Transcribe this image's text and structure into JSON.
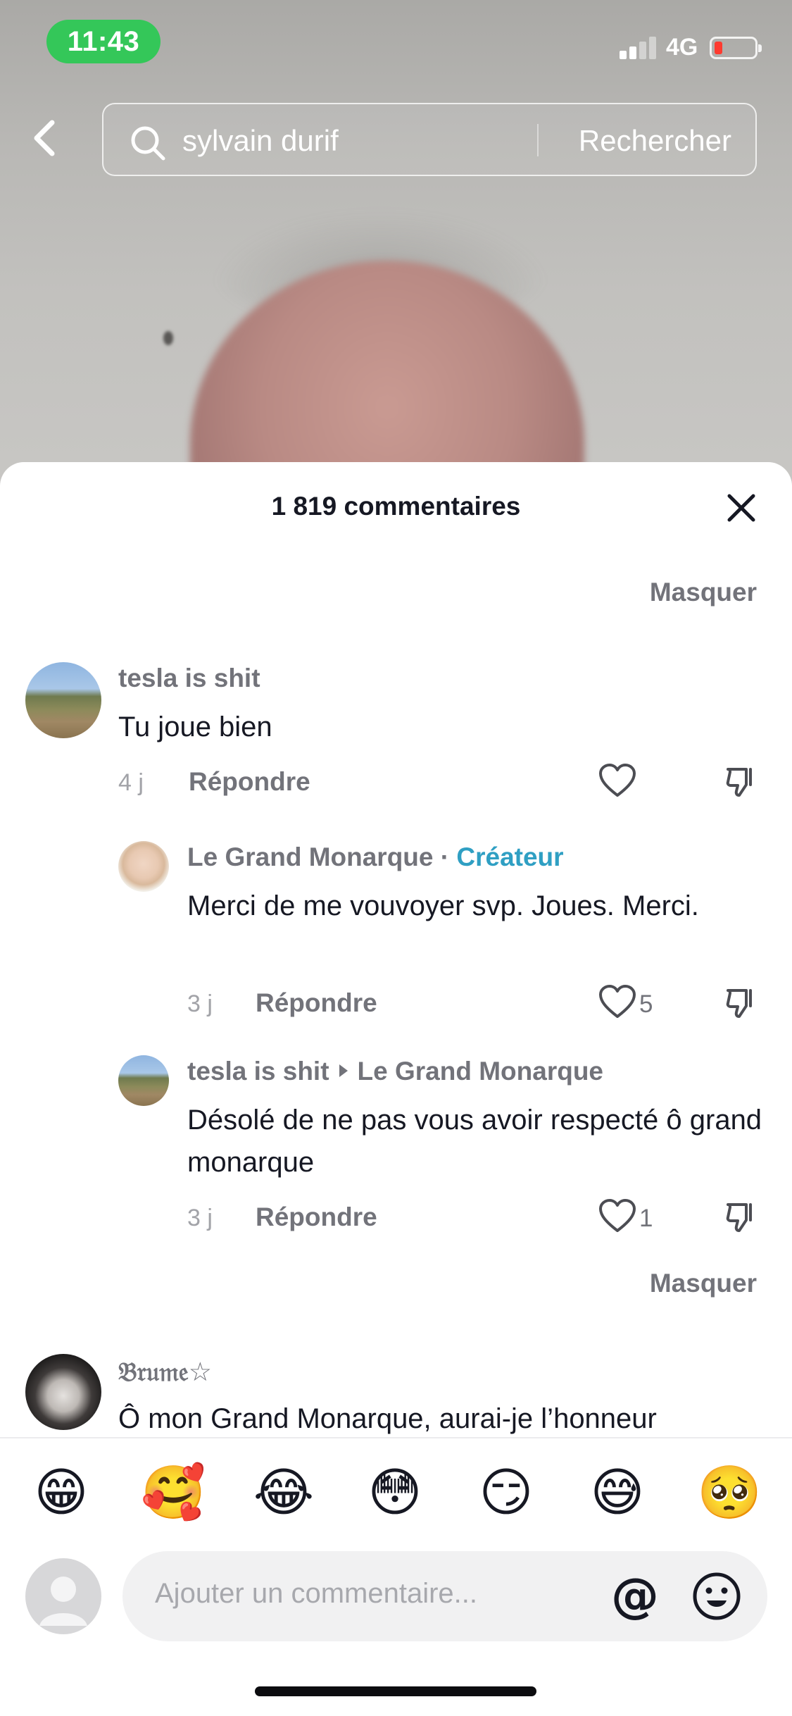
{
  "status_bar": {
    "time": "11:43",
    "network": "4G",
    "colors": {
      "time_pill": "#34c759",
      "battery_low": "#ff3b30"
    }
  },
  "search": {
    "query": "sylvain durif",
    "submit_label": "Rechercher"
  },
  "comments_panel": {
    "title": "1 819 commentaires",
    "hide_label": "Masquer",
    "reply_label": "Répondre",
    "creator_badge": "Créateur",
    "creator_color": "#2f9fc3"
  },
  "comments": [
    {
      "author": "tesla is shit",
      "text": "Tu joue bien",
      "date": "4 j",
      "likes": ""
    },
    {
      "author": "Le Grand Monarque",
      "text": "Merci de me vouvoyer svp. Joues. Merci.",
      "date": "3 j",
      "likes": "5"
    },
    {
      "author": "tesla is shit",
      "reply_to": "Le Grand Monarque",
      "text": "Désolé de ne pas vous avoir respecté ô grand monarque",
      "date": "3 j",
      "likes": "1"
    },
    {
      "author": "𝔅𝔯𝔲𝔪𝔢☆",
      "text": "Ô mon Grand Monarque, aurai-je l’honneur"
    }
  ],
  "emoji_bar": [
    "😁",
    "🥰",
    "😂",
    "😳",
    "😏",
    "😅",
    "🥺"
  ],
  "composer": {
    "placeholder": "Ajouter un commentaire...",
    "mention_symbol": "@"
  },
  "icons": {
    "back": "chevron-left-icon",
    "search": "search-icon",
    "close": "close-icon",
    "like": "heart-icon",
    "dislike": "thumbs-down-icon",
    "emoji": "emoji-face-icon"
  }
}
